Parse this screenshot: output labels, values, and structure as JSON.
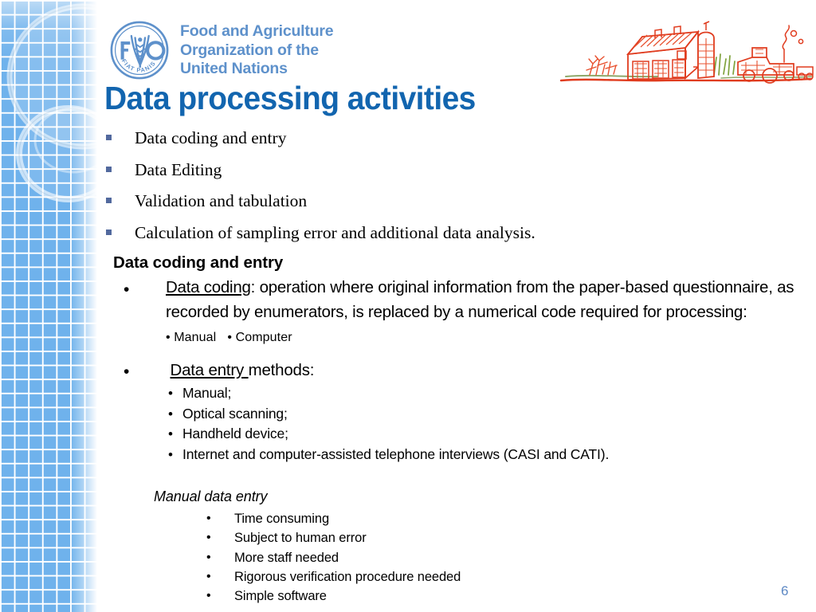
{
  "branding": {
    "emblem_name": "fao-emblem",
    "emblem_motto": "FIAT PANIS",
    "emblem_letters": "FAO",
    "wordmark_line1": "Food and Agriculture",
    "wordmark_line2": "Organization of the",
    "wordmark_line3": "United Nations",
    "wordmark_color": "#5E91CB",
    "illustration_name": "farm-barn-silo-tractor-sketch",
    "illustration_color": "#E03C1F"
  },
  "title": {
    "text": "Data processing activities",
    "color": "#1265AF"
  },
  "top_list": {
    "bullet_color": "#52699E",
    "items": [
      "Data coding and entry",
      "Data Editing",
      "Validation and tabulation",
      "Calculation of sampling error and additional data analysis."
    ]
  },
  "section": {
    "heading": "Data coding and entry"
  },
  "coding": {
    "bullet": "•",
    "term": "Data coding",
    "body": ": operation where original information from the paper-based questionnaire, as recorded by enumerators, is replaced by a numerical code required for processing:",
    "inline_options": [
      {
        "bullet": "•",
        "label": "Manual"
      },
      {
        "bullet": "•",
        "label": "Computer"
      }
    ]
  },
  "entry": {
    "bullet": "•",
    "term": "Data entry ",
    "heading_rest": "methods:",
    "item_bullet": "•",
    "items": [
      "Manual;",
      "Optical scanning;",
      "Handheld device;",
      "Internet and computer-assisted telephone interviews (CASI and CATI)."
    ]
  },
  "manual": {
    "heading": "Manual data entry",
    "item_bullet": "•",
    "items": [
      "Time consuming",
      "Subject to human error",
      "More staff needed",
      "Rigorous verification procedure needed",
      "Simple software"
    ]
  },
  "footer": {
    "page_number": "6",
    "page_number_color": "#5E89C4"
  },
  "sidebar": {
    "grid_color": "#71B3EC",
    "line_color": "#FFFFFF",
    "name": "decorative-blue-grid-panel"
  }
}
